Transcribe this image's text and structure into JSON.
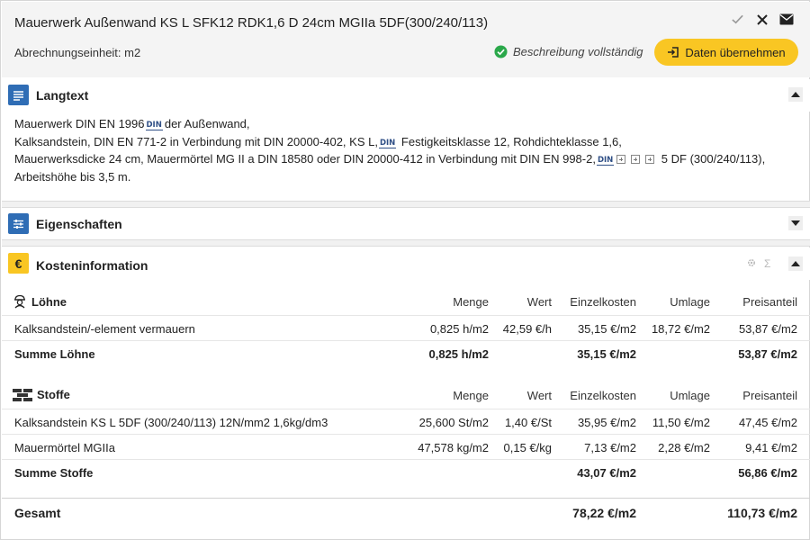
{
  "header": {
    "title": "Mauerwerk Außenwand KS L SFK12 RDK1,6 D 24cm MGIIa 5DF(300/240/113)",
    "unit_label": "Abrechnungseinheit: m2",
    "status": "Beschreibung vollständig",
    "apply_button": "Daten übernehmen",
    "icons": [
      "check-icon",
      "close-icon",
      "mail-icon"
    ]
  },
  "langtext": {
    "title": "Langtext",
    "line1a": "Mauerwerk DIN EN 1996",
    "line1b": "der Außenwand,",
    "line2a": "Kalksandstein, DIN EN 771-2 in Verbindung mit DIN 20000-402, KS L,",
    "line2b": "Festigkeitsklasse 12, Rohdichteklasse 1,6,",
    "line3a": "Mauerwerksdicke 24 cm, Mauermörtel MG II a DIN 18580 oder DIN 20000-412 in Verbindung mit DIN EN 998-2,",
    "line3b": "5 DF (300/240/113),",
    "line4": "Arbeitshöhe bis 3,5 m.",
    "din_badge": "DIN"
  },
  "eigenschaften": {
    "title": "Eigenschaften"
  },
  "kosten": {
    "title": "Kosteninformation",
    "icon_symbol": "€",
    "sum_symbol": "Σ",
    "columns": {
      "menge": "Menge",
      "wert": "Wert",
      "einzelkosten": "Einzelkosten",
      "umlage": "Umlage",
      "preisanteil": "Preisanteil"
    },
    "loehne": {
      "title": "Löhne",
      "rows": [
        {
          "name": "Kalksandstein/-element vermauern",
          "menge": "0,825 h/m2",
          "wert": "42,59 €/h",
          "einzelkosten": "35,15 €/m2",
          "umlage": "18,72 €/m2",
          "preisanteil": "53,87 €/m2"
        }
      ],
      "sum": {
        "name": "Summe Löhne",
        "menge": "0,825 h/m2",
        "einzelkosten": "35,15 €/m2",
        "preisanteil": "53,87 €/m2"
      }
    },
    "stoffe": {
      "title": "Stoffe",
      "rows": [
        {
          "name": "Kalksandstein KS L 5DF (300/240/113) 12N/mm2 1,6kg/dm3",
          "menge": "25,600 St/m2",
          "wert": "1,40 €/St",
          "einzelkosten": "35,95 €/m2",
          "umlage": "11,50 €/m2",
          "preisanteil": "47,45 €/m2"
        },
        {
          "name": "Mauermörtel MGIIa",
          "menge": "47,578 kg/m2",
          "wert": "0,15 €/kg",
          "einzelkosten": "7,13 €/m2",
          "umlage": "2,28 €/m2",
          "preisanteil": "9,41 €/m2"
        }
      ],
      "sum": {
        "name": "Summe Stoffe",
        "einzelkosten": "43,07 €/m2",
        "preisanteil": "56,86 €/m2"
      }
    },
    "gesamt": {
      "label": "Gesamt",
      "einzelkosten": "78,22 €/m2",
      "preisanteil": "110,73 €/m2"
    }
  },
  "colors": {
    "accent": "#f9c623",
    "blue_icon": "#2f6db5",
    "success": "#2aa84a"
  }
}
